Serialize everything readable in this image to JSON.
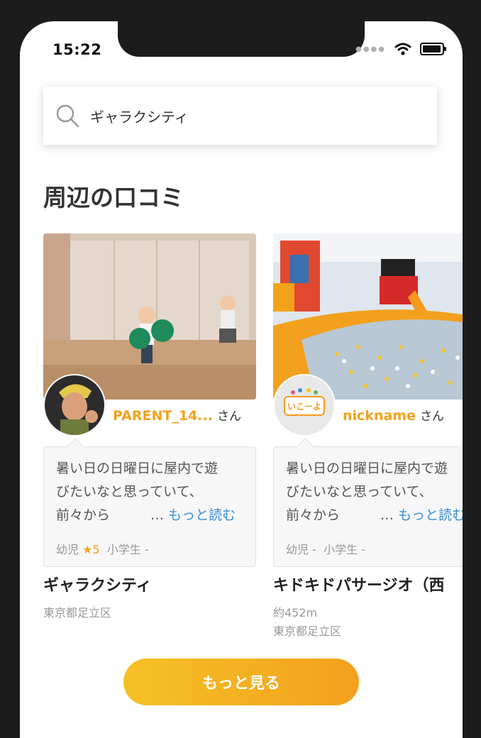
{
  "status_bar": {
    "time": "15:22"
  },
  "search": {
    "value": "ギャラクシティ"
  },
  "section": {
    "title": "周辺の口コミ"
  },
  "cards": [
    {
      "user_name": "PARENT_14...",
      "honorific": "さん",
      "review_lines": [
        "暑い日の日曜日に屋内で遊",
        "びたいなと思っていて、",
        "前々から　　　…"
      ],
      "more_link": "もっと読む",
      "tag_toddler": "幼児",
      "tag_toddler_rating": "★5",
      "tag_school": "小学生",
      "tag_school_rating": "-",
      "place_name": "ギャラクシティ",
      "distance": "",
      "address": "東京都足立区"
    },
    {
      "user_name": "nickname",
      "honorific": "さん",
      "avatar_logo_text": "いこーよ",
      "review_lines": [
        "暑い日の日曜日に屋内で遊",
        "びたいなと思っていて、",
        "前々から　　　…"
      ],
      "more_link": "もっと読む",
      "tag_toddler": "幼児",
      "tag_toddler_rating": "-",
      "tag_school": "小学生",
      "tag_school_rating": "-",
      "place_name": "キドキドパサージオ（西",
      "distance": "約452m",
      "address": "東京都足立区"
    }
  ],
  "more_button": {
    "label": "もっと見る"
  },
  "colors": {
    "accent": "#f4a21a",
    "link": "#3a8ed8",
    "button_start": "#f5c125",
    "button_end": "#f3a01e"
  },
  "icons": [
    "search-icon",
    "wifi-icon",
    "battery-icon",
    "cellular-signal-icon"
  ]
}
